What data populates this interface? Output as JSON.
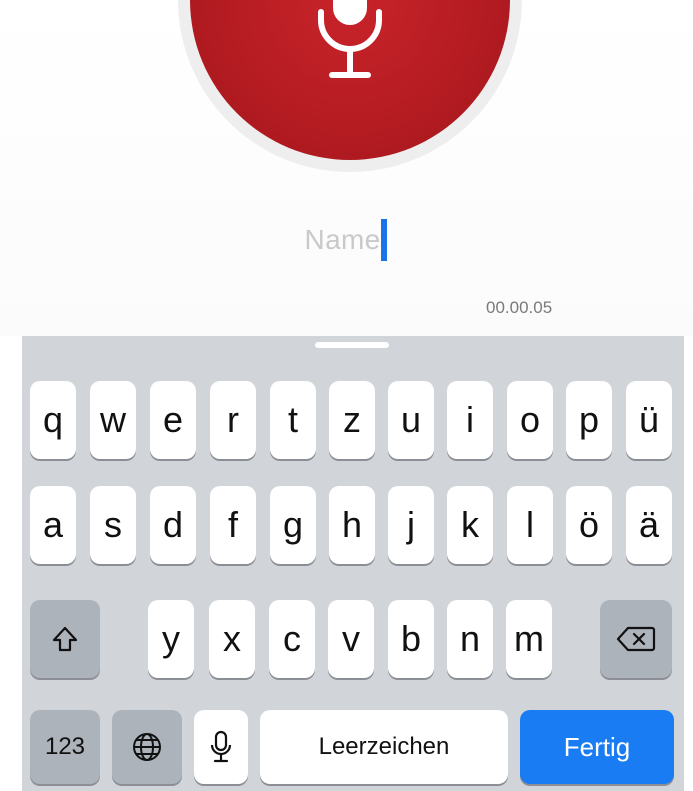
{
  "recorder": {
    "name_placeholder": "Name",
    "elapsed": "00.00.05"
  },
  "keyboard": {
    "row1": [
      "q",
      "w",
      "e",
      "r",
      "t",
      "z",
      "u",
      "i",
      "o",
      "p",
      "ü"
    ],
    "row2": [
      "a",
      "s",
      "d",
      "f",
      "g",
      "h",
      "j",
      "k",
      "l",
      "ö",
      "ä"
    ],
    "row3": [
      "y",
      "x",
      "c",
      "v",
      "b",
      "n",
      "m"
    ],
    "numbers_label": "123",
    "space_label": "Leerzeichen",
    "done_label": "Fertig",
    "icons": {
      "shift": "shift-icon",
      "backspace": "backspace-icon",
      "globe": "globe-icon",
      "dictation": "microphone-icon"
    }
  },
  "colors": {
    "record": "#b51c22",
    "accent": "#1a7cf2",
    "keyboard_bg": "#d1d4d9"
  }
}
